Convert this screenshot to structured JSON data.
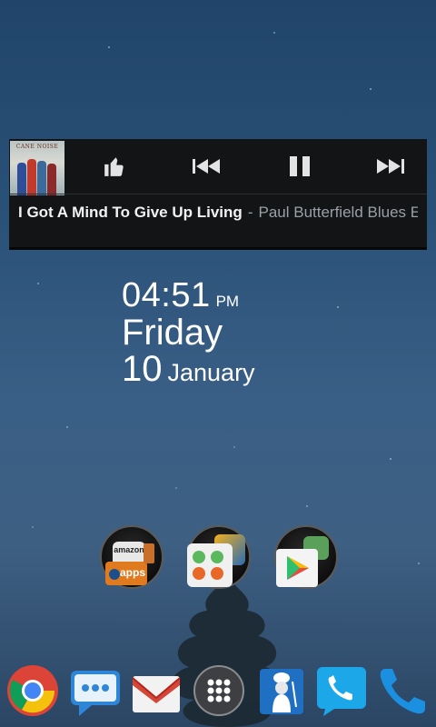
{
  "music_widget": {
    "album_art_text": "CANE NOISE",
    "song_title": "I Got A Mind To Give Up Living",
    "separator": "-",
    "artist": "Paul Butterfield Blues E",
    "controls": [
      {
        "icon": "thumbs-up-icon"
      },
      {
        "icon": "previous-icon"
      },
      {
        "icon": "pause-icon"
      },
      {
        "icon": "next-icon"
      }
    ]
  },
  "clock": {
    "time": "04:51",
    "ampm": "PM",
    "day": "Friday",
    "date_num": "10",
    "month": "January"
  },
  "folders": [
    {
      "name": "amazon-apps-folder",
      "labels": {
        "top": "amazon",
        "bottom": "apps"
      }
    },
    {
      "name": "apps-folder"
    },
    {
      "name": "play-store-folder"
    }
  ],
  "dock": [
    {
      "icon": "chrome-icon"
    },
    {
      "icon": "messaging-icon"
    },
    {
      "icon": "gmail-icon"
    },
    {
      "icon": "app-drawer-icon"
    },
    {
      "icon": "chef-app-icon"
    },
    {
      "icon": "phone-icon"
    },
    {
      "icon": "phone-handset-icon"
    }
  ],
  "colors": {
    "widget_bg": "#121416",
    "artist_gray": "#9aa0a6",
    "chrome_red": "#db4437",
    "chrome_yellow": "#f4c20d",
    "chrome_green": "#0f9d58",
    "chrome_blue": "#4285f4",
    "phone_blue": "#1b8fe0"
  }
}
